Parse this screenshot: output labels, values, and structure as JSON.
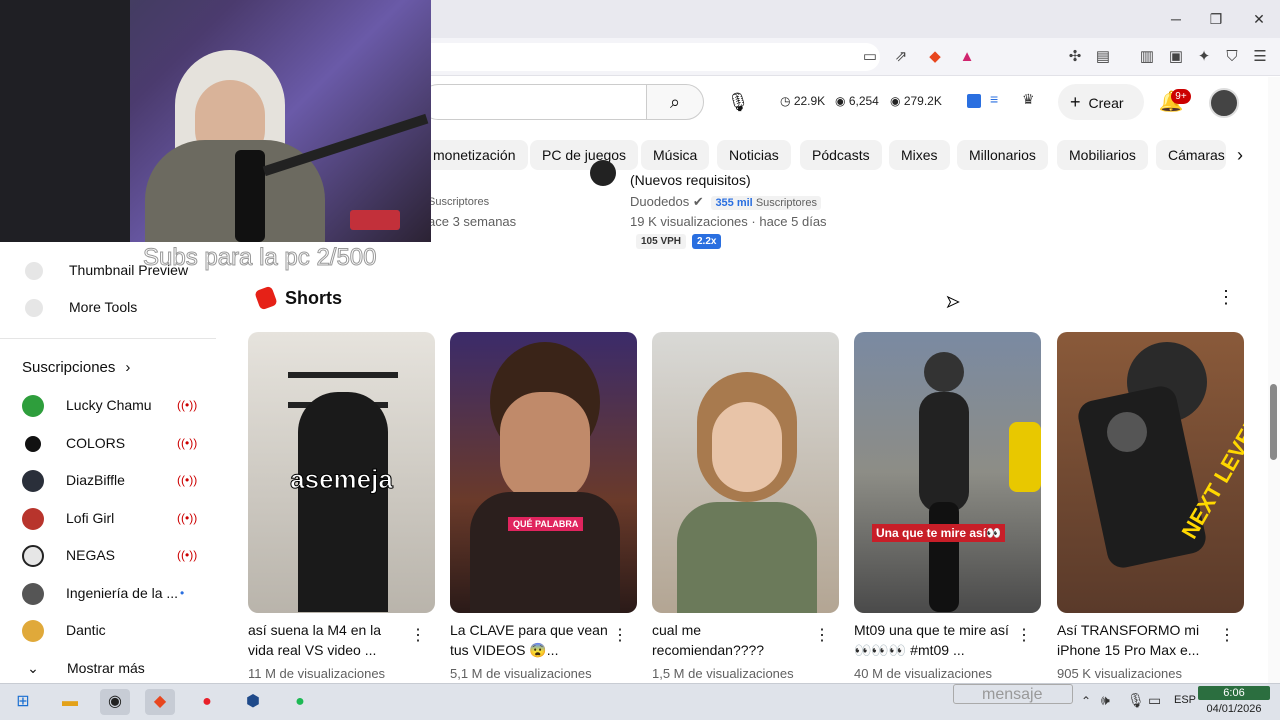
{
  "header": {
    "create_label": "Crear",
    "notif_count": "9+",
    "stats": [
      "22.9K",
      "6,254",
      "279.2K"
    ]
  },
  "chips": [
    "monetización",
    "PC de juegos",
    "Música",
    "Noticias",
    "Pódcasts",
    "Mixes",
    "Millonarios",
    "Mobiliarios",
    "Cámaras f"
  ],
  "videos_top": {
    "left_subs": "Suscriptores",
    "left_time": "ace 3 semanas",
    "right_title": "(Nuevos requisitos)",
    "right_channel": "Duodedos",
    "right_subs": "355 mil",
    "right_subs_suffix": "Suscriptores",
    "right_meta": "19 K visualizaciones · hace 5 días",
    "right_vph": "105 VPH",
    "right_mult": "2.2x"
  },
  "overlay": {
    "stream_text": "Subs para la pc 2/500",
    "message_label": "mensaje"
  },
  "sidebar": {
    "tools": [
      "Thumbnail Preview",
      "More Tools"
    ],
    "subs_header": "Suscripciones",
    "subs": [
      {
        "name": "Lucky Chamu",
        "live": true,
        "color": "#2e9e3c"
      },
      {
        "name": "COLORS",
        "live": true,
        "color": "#111111"
      },
      {
        "name": "DiazBiffle",
        "live": true,
        "color": "#2a2f3a"
      },
      {
        "name": "Lofi Girl",
        "live": true,
        "color": "#b8342c"
      },
      {
        "name": "NEGAS",
        "live": true,
        "color": "#e6e6e6"
      },
      {
        "name": "Ingeniería de la ...",
        "live": false,
        "color": "#555555"
      },
      {
        "name": "Dantic",
        "live": false,
        "color": "#e0a93a"
      }
    ],
    "show_more": "Mostrar más"
  },
  "shorts": {
    "title": "Shorts",
    "items": [
      {
        "title": "así suena la M4 en la vida real VS video ...",
        "views": "11 M de visualizaciones",
        "caption": "asemeja",
        "bg": "#cfcbc4"
      },
      {
        "title": "La CLAVE para que vean tus VIDEOS 😨...",
        "views": "5,1 M de visualizaciones",
        "caption": "QUÉ PALABRA",
        "bg": "#4a2f2a"
      },
      {
        "title": "cual me recomiendan????",
        "views": "1,5 M de visualizaciones",
        "caption": "",
        "bg": "#c9b6a4"
      },
      {
        "title": "Mt09 una que te mire así 👀👀👀 #mt09 ...",
        "views": "40 M de visualizaciones",
        "caption": "Una que te mire así👀",
        "bg": "#8a8f96"
      },
      {
        "title": "Así TRANSFORMO mi iPhone 15 Pro Max e...",
        "views": "905 K visualizaciones",
        "caption": "NEXT LEVEL!",
        "bg": "#5a3a2a"
      }
    ]
  },
  "taskbar": {
    "lang": "ESP",
    "time": "6:06",
    "date": "04/01/2026"
  }
}
